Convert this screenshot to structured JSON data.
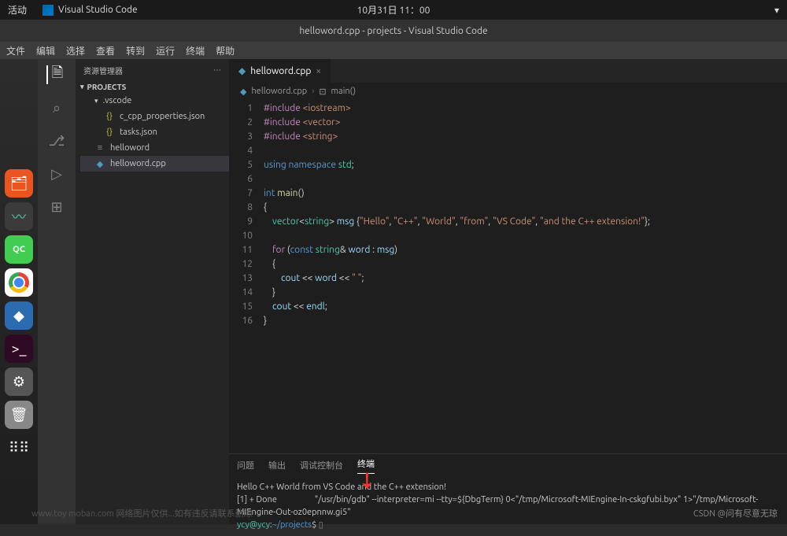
{
  "topbar": {
    "activities": "活动",
    "app_name": "Visual Studio Code",
    "clock": "10月31日  11：00"
  },
  "title": "helloword.cpp - projects - Visual Studio Code",
  "menu": [
    "文件",
    "编辑",
    "选择",
    "查看",
    "转到",
    "运行",
    "终端",
    "帮助"
  ],
  "sidebar": {
    "title": "资源管理器",
    "section": "PROJECTS",
    "items": [
      {
        "label": ".vscode",
        "icon": "folder",
        "indent": 0,
        "chev": "▾"
      },
      {
        "label": "c_cpp_properties.json",
        "icon": "json",
        "indent": 1
      },
      {
        "label": "tasks.json",
        "icon": "json",
        "indent": 1
      },
      {
        "label": "helloword",
        "icon": "bin",
        "indent": 0
      },
      {
        "label": "helloword.cpp",
        "icon": "cpp",
        "indent": 0,
        "selected": true
      }
    ]
  },
  "tabs": [
    {
      "label": "helloword.cpp",
      "icon": "cpp"
    }
  ],
  "breadcrumb": {
    "file": "helloword.cpp",
    "symbol": "main()"
  },
  "code": {
    "lines": [
      {
        "n": 1,
        "html": "<span class='kw2'>#include</span> <span class='str'>&lt;iostream&gt;</span>"
      },
      {
        "n": 2,
        "html": "<span class='kw2'>#include</span> <span class='str'>&lt;vector&gt;</span>"
      },
      {
        "n": 3,
        "html": "<span class='kw2'>#include</span> <span class='str'>&lt;string&gt;</span>"
      },
      {
        "n": 4,
        "html": ""
      },
      {
        "n": 5,
        "html": "<span class='kw'>using</span> <span class='kw'>namespace</span> <span class='type'>std</span>;"
      },
      {
        "n": 6,
        "html": ""
      },
      {
        "n": 7,
        "html": "<span class='kw'>int</span> <span class='fn'>main</span>()"
      },
      {
        "n": 8,
        "html": "{"
      },
      {
        "n": 9,
        "html": "    <span class='type'>vector</span>&lt;<span class='type'>string</span>&gt; <span class='var'>msg</span> {<span class='str'>\"Hello\"</span>, <span class='str'>\"C++\"</span>, <span class='str'>\"World\"</span>, <span class='str'>\"from\"</span>, <span class='str'>\"VS Code\"</span>, <span class='str'>\"and the C++ extension!\"</span>};"
      },
      {
        "n": 10,
        "html": ""
      },
      {
        "n": 11,
        "html": "    <span class='kw2'>for</span> (<span class='kw'>const</span> <span class='type'>string</span>&amp; <span class='var'>word</span> : <span class='var'>msg</span>)"
      },
      {
        "n": 12,
        "html": "    {"
      },
      {
        "n": 13,
        "html": "        <span class='var'>cout</span> &lt;&lt; <span class='var'>word</span> &lt;&lt; <span class='str'>\" \"</span>;"
      },
      {
        "n": 14,
        "html": "    }"
      },
      {
        "n": 15,
        "html": "    <span class='var'>cout</span> &lt;&lt; <span class='var'>endl</span>;"
      },
      {
        "n": 16,
        "html": "}"
      }
    ]
  },
  "panel": {
    "tabs": [
      "问题",
      "输出",
      "调试控制台",
      "终端"
    ],
    "active": "终端",
    "output_line1": "Hello C++ World from VS Code and the C++ extension!",
    "output_line2_a": "[1] + Done",
    "output_line2_b": "\"/usr/bin/gdb\" --interpreter=mi --tty=${DbgTerm} 0<\"/tmp/Microsoft-MIEngine-In-cskgfubi.byx\" 1>\"/tmp/Microsoft-MIEngine-Out-oz0epnnw.gi5\"",
    "prompt_user": "ycy@ycy",
    "prompt_path": "~/projects",
    "prompt_end": "$"
  },
  "watermark": "CSDN @问有尽意无琼",
  "bottom_wm": "www.toy moban.com 网络图片仅供...如有违反请联系删除"
}
